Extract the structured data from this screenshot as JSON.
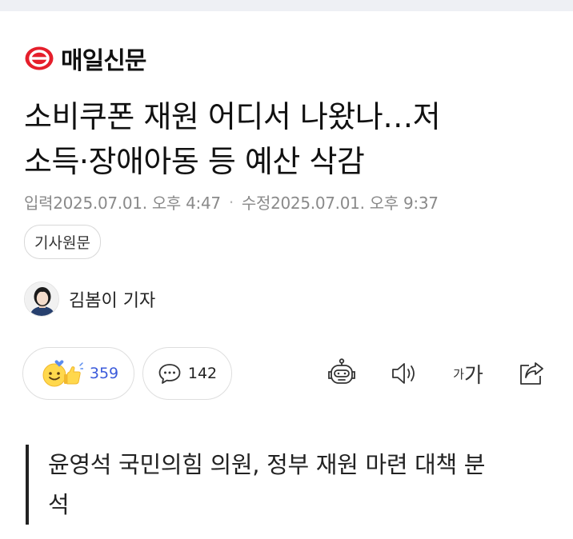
{
  "press": {
    "name": "매일신문",
    "logo": "maeil-logo-icon"
  },
  "article": {
    "title_line1": "소비쿠폰 재원 어디서 나왔나…저",
    "title_line2": "소득·장애아동 등 예산 삭감",
    "input_label": "입력",
    "input_time": "2025.07.01. 오후 4:47",
    "edit_label": "수정",
    "edit_time": "2025.07.01. 오후 9:37",
    "original_button": "기사원문",
    "reporter": "김봄이 기자",
    "summary_line1": "윤영석 국민의힘 의원, 정부 재원 마련 대책 분",
    "summary_line2": "석"
  },
  "actions": {
    "reaction_count": "359",
    "comment_count": "142",
    "font_small": "가",
    "font_large": "가",
    "icons": [
      "reaction-emoji-icon",
      "comment-bubble-icon",
      "robot-summary-icon",
      "speaker-icon",
      "font-size-icon",
      "share-icon"
    ]
  },
  "colors": {
    "brand": "#e51e2b",
    "reaction_count": "#3b5bdb",
    "meta": "#8a8a8a"
  }
}
